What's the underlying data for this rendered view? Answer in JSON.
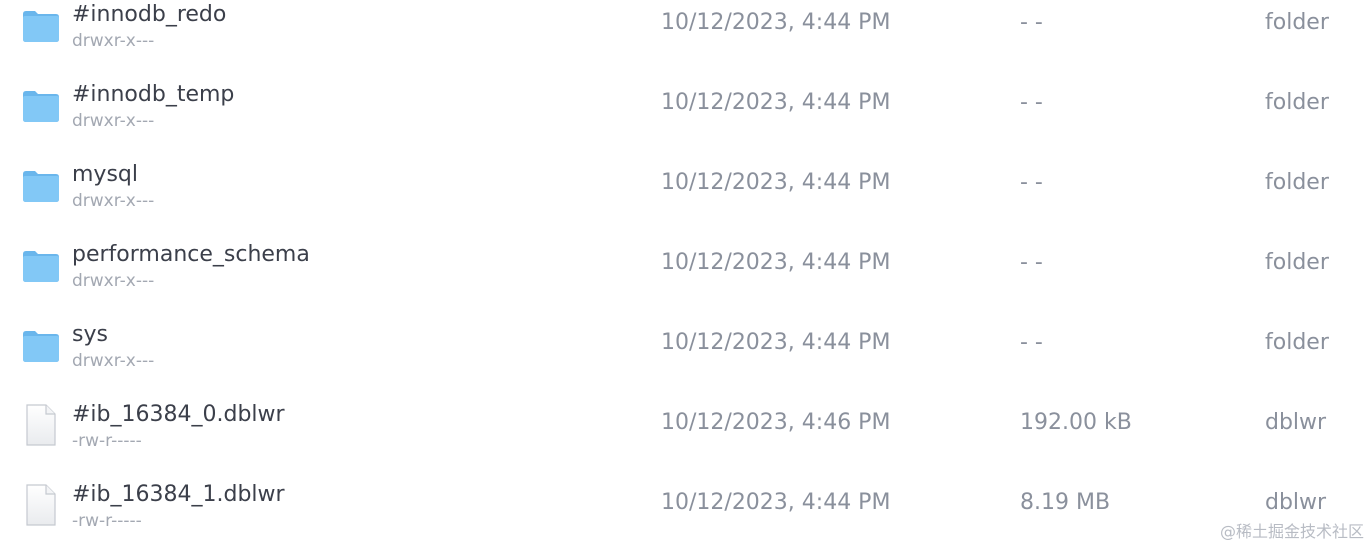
{
  "files": [
    {
      "name": "#innodb_redo",
      "perm": "drwxr-x---",
      "date": "10/12/2023, 4:44 PM",
      "size": "- -",
      "kind": "folder",
      "icon": "folder-icon"
    },
    {
      "name": "#innodb_temp",
      "perm": "drwxr-x---",
      "date": "10/12/2023, 4:44 PM",
      "size": "- -",
      "kind": "folder",
      "icon": "folder-icon"
    },
    {
      "name": "mysql",
      "perm": "drwxr-x---",
      "date": "10/12/2023, 4:44 PM",
      "size": "- -",
      "kind": "folder",
      "icon": "folder-icon"
    },
    {
      "name": "performance_schema",
      "perm": "drwxr-x---",
      "date": "10/12/2023, 4:44 PM",
      "size": "- -",
      "kind": "folder",
      "icon": "folder-icon"
    },
    {
      "name": "sys",
      "perm": "drwxr-x---",
      "date": "10/12/2023, 4:44 PM",
      "size": "- -",
      "kind": "folder",
      "icon": "folder-icon"
    },
    {
      "name": "#ib_16384_0.dblwr",
      "perm": "-rw-r-----",
      "date": "10/12/2023, 4:46 PM",
      "size": "192.00 kB",
      "kind": "dblwr",
      "icon": "file-icon"
    },
    {
      "name": "#ib_16384_1.dblwr",
      "perm": "-rw-r-----",
      "date": "10/12/2023, 4:44 PM",
      "size": "8.19 MB",
      "kind": "dblwr",
      "icon": "file-icon"
    }
  ],
  "watermark": "@稀土掘金技术社区",
  "colors": {
    "folder": "#7cc4f4",
    "folder_tab": "#6ab6ec",
    "file_border": "#c5c9d0"
  }
}
